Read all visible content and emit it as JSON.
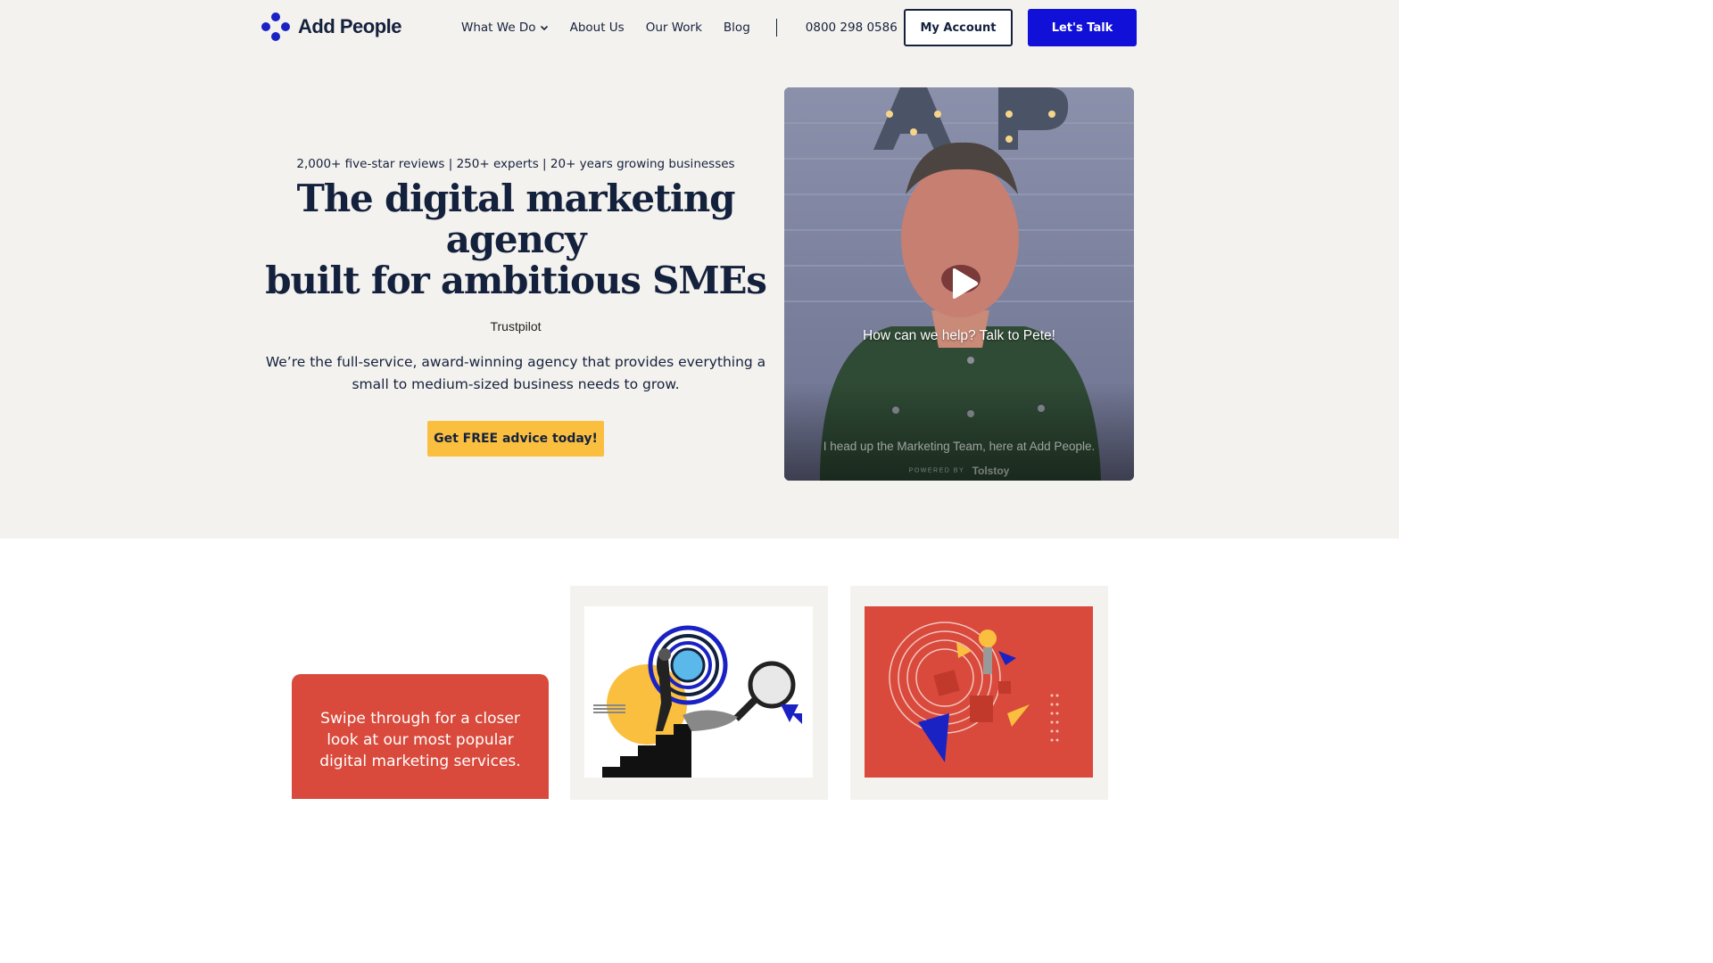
{
  "header": {
    "logo_text": "Add People",
    "nav": [
      {
        "label": "What We Do",
        "has_dropdown": true
      },
      {
        "label": "About Us"
      },
      {
        "label": "Our Work"
      },
      {
        "label": "Blog"
      }
    ],
    "phone": "0800 298 0586",
    "account_button": "My Account",
    "talk_button": "Let's Talk",
    "brand_color": "#1a22c4",
    "cta_color": "#1010d8"
  },
  "hero": {
    "stats": "2,000+ five-star reviews | 250+ experts | 20+ years growing businesses",
    "headline_line1": "The digital marketing agency",
    "headline_line2": "built for ambitious SMEs",
    "trustpilot": "Trustpilot",
    "intro": "We’re the full-service, award-winning agency that provides everything a small to medium-sized business needs to grow.",
    "cta": "Get FREE advice today!",
    "cta_color": "#fbbf3f",
    "background": "#f4f2ee"
  },
  "video": {
    "prompt": "How can we help? Talk to Pete!",
    "caption": "I head up the Marketing Team, here at Add People.",
    "powered_by": "POWERED BY",
    "provider": "Tolstoy",
    "play_icon": "play-icon"
  },
  "services": {
    "swipe_text": "Swipe through for a closer look at our most popular digital marketing services.",
    "swipe_color": "#d94a3c",
    "cards": [
      {
        "illustration": "seo-magnifier-stairs-illustration"
      },
      {
        "illustration": "creative-lightbulb-shapes-illustration"
      }
    ]
  }
}
